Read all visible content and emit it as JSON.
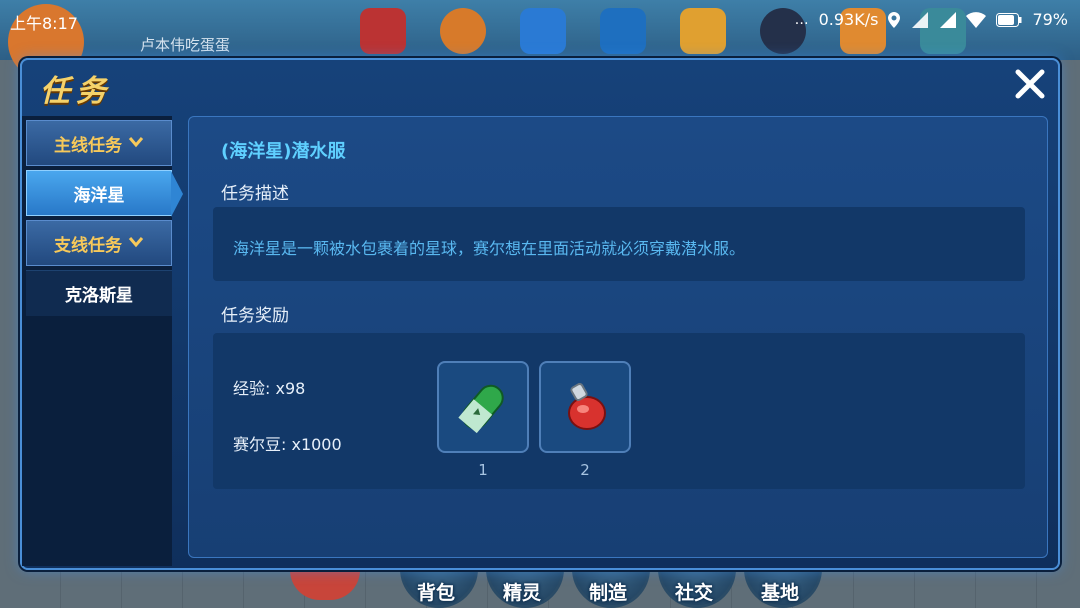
{
  "status_bar": {
    "time": "上午8:17",
    "network_speed": "0.93K/s",
    "battery": "79%"
  },
  "background": {
    "player_name": "卢本伟吃蛋蛋",
    "bottom_buttons": [
      "背包",
      "精灵",
      "制造",
      "社交",
      "基地"
    ]
  },
  "dialog": {
    "title": "任务",
    "sidebar": {
      "items": [
        {
          "label": "主线任务",
          "type": "category"
        },
        {
          "label": "海洋星",
          "type": "selected"
        },
        {
          "label": "支线任务",
          "type": "category"
        },
        {
          "label": "克洛斯星",
          "type": "plain"
        }
      ]
    },
    "task": {
      "title": "(海洋星)潜水服",
      "description_label": "任务描述",
      "description": "海洋星是一颗被水包裹着的星球，赛尔想在里面活动就必须穿戴潜水服。",
      "reward_label": "任务奖励",
      "rewards": {
        "exp": "经验: x98",
        "beans": "赛尔豆: x1000",
        "items": [
          {
            "name": "capsule-item-icon",
            "count": "1"
          },
          {
            "name": "potion-item-icon",
            "count": "2"
          }
        ]
      }
    }
  },
  "colors": {
    "title_gold": "#f5d26a",
    "task_title_cyan": "#5fd0ff",
    "description_blue": "#59b8f0",
    "panel_blue": "#173f74"
  }
}
